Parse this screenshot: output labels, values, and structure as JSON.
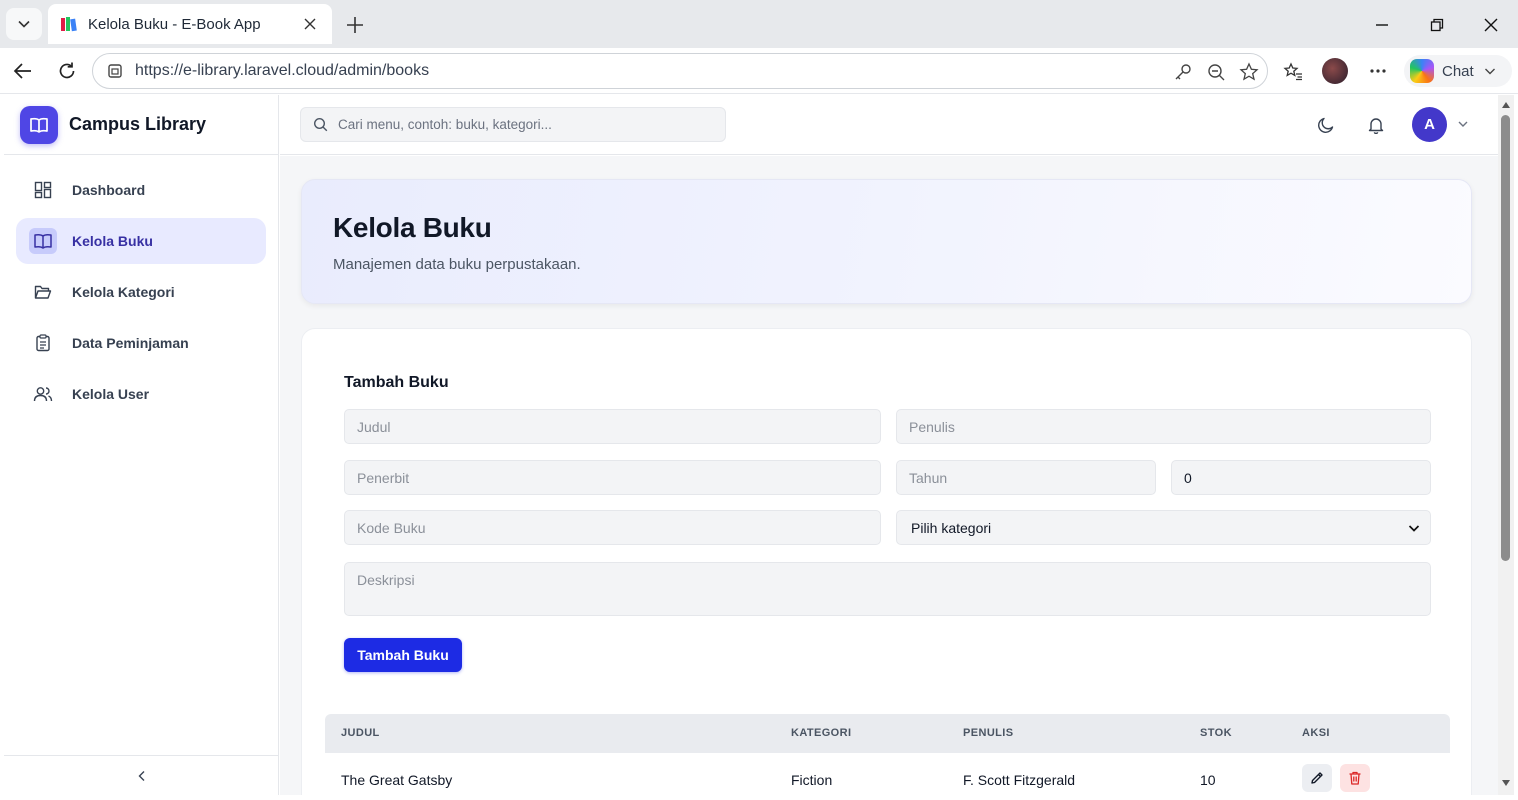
{
  "browser": {
    "tab_title": "Kelola Buku - E-Book App",
    "url": "https://e-library.laravel.cloud/admin/books",
    "chat_label": "Chat"
  },
  "brand": {
    "name": "Campus Library"
  },
  "sidebar": {
    "items": [
      {
        "label": "Dashboard",
        "icon": "dashboard-grid-icon",
        "active": false
      },
      {
        "label": "Kelola Buku",
        "icon": "book-open-icon",
        "active": true
      },
      {
        "label": "Kelola Kategori",
        "icon": "folder-open-icon",
        "active": false
      },
      {
        "label": "Data Peminjaman",
        "icon": "clipboard-list-icon",
        "active": false
      },
      {
        "label": "Kelola User",
        "icon": "users-icon",
        "active": false
      }
    ]
  },
  "topbar": {
    "search_placeholder": "Cari menu, contoh: buku, kategori...",
    "avatar_initial": "A"
  },
  "page": {
    "title": "Kelola Buku",
    "subtitle": "Manajemen data buku perpustakaan."
  },
  "form": {
    "heading": "Tambah Buku",
    "judul_placeholder": "Judul",
    "penulis_placeholder": "Penulis",
    "penerbit_placeholder": "Penerbit",
    "tahun_placeholder": "Tahun",
    "stok_value": "0",
    "kode_placeholder": "Kode Buku",
    "kategori_selected": "Pilih kategori",
    "deskripsi_placeholder": "Deskripsi",
    "submit_label": "Tambah Buku"
  },
  "table": {
    "headers": {
      "judul": "JUDUL",
      "kategori": "KATEGORI",
      "penulis": "PENULIS",
      "stok": "STOK",
      "aksi": "AKSI"
    },
    "rows": [
      {
        "judul": "The Great Gatsby",
        "kategori": "Fiction",
        "penulis": "F. Scott Fitzgerald",
        "stok": "10"
      }
    ]
  },
  "colors": {
    "primary": "#1d2be4",
    "brand": "#4f46e5",
    "active_nav_bg": "#e8eaff",
    "danger": "#dc2626"
  }
}
